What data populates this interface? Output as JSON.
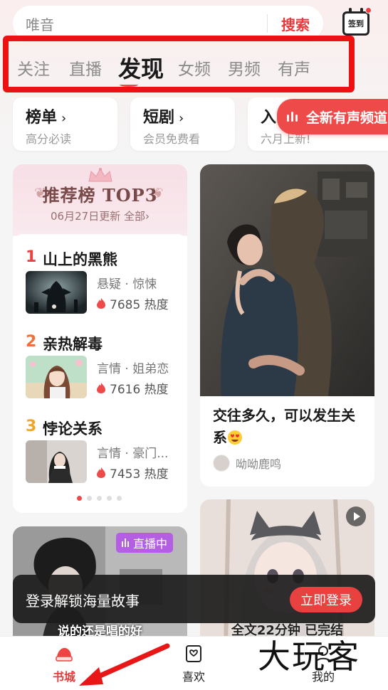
{
  "search": {
    "placeholder": "唯音",
    "button": "搜索"
  },
  "signin": {
    "label": "签到"
  },
  "category_tabs": [
    {
      "label": "关注",
      "active": false
    },
    {
      "label": "直播",
      "active": false
    },
    {
      "label": "发现",
      "active": true
    },
    {
      "label": "女频",
      "active": false
    },
    {
      "label": "男频",
      "active": false
    },
    {
      "label": "有声",
      "active": false
    }
  ],
  "quick_entries": [
    {
      "title": "榜单",
      "subtitle": "高分必读"
    },
    {
      "title": "短剧",
      "subtitle": "会员免费看"
    },
    {
      "title": "入",
      "subtitle": "六月上新!"
    }
  ],
  "audio_banner": {
    "label": "全新有声频道"
  },
  "ranking": {
    "title": "推荐榜 TOP3",
    "subtitle": "06月27日更新 全部›",
    "items": [
      {
        "rank": "1",
        "name": "山上的黑熊",
        "tags": "悬疑 · 惊悚",
        "heat": "7685 热度",
        "rank_color": "#e84242"
      },
      {
        "rank": "2",
        "name": "亲热解毒",
        "tags": "言情 · 姐弟恋",
        "heat": "7616 热度",
        "rank_color": "#f0703a"
      },
      {
        "rank": "3",
        "name": "悖论关系",
        "tags": "言情 · 豪门...",
        "heat": "7453 热度",
        "rank_color": "#f2a627"
      }
    ],
    "page_count": 5,
    "active_page": 1
  },
  "post": {
    "title": "交往多久，可以发生关系",
    "author": "呦呦鹿鸣"
  },
  "live_card": {
    "badge": "直播中",
    "caption": "说的还是唱的好"
  },
  "anime_card": {
    "caption": "全文22分钟 已完结"
  },
  "login_toast": {
    "message": "登录解锁海量故事",
    "button": "立即登录"
  },
  "bottom_nav": [
    {
      "label": "书城",
      "active": true
    },
    {
      "label": "喜欢",
      "active": false
    },
    {
      "label": "我的",
      "active": false
    }
  ],
  "watermark": "大玩客",
  "colors": {
    "accent": "#e83a3a",
    "highlight_border": "#ee1111",
    "live_badge": "#b35ee3"
  }
}
